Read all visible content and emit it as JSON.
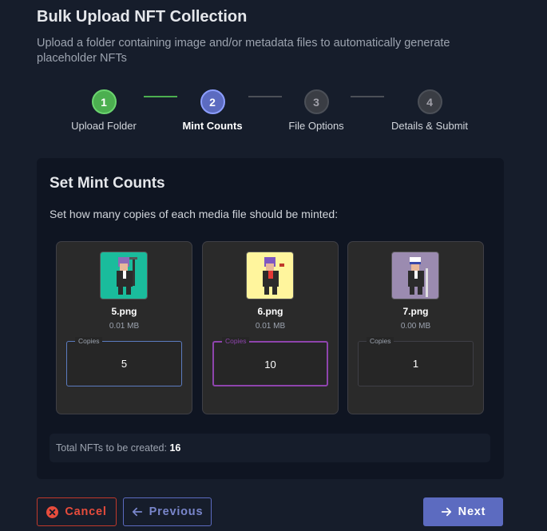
{
  "header": {
    "title": "Bulk Upload NFT Collection",
    "subtitle": "Upload a folder containing image and/or metadata files to automatically generate placeholder NFTs"
  },
  "stepper": {
    "steps": [
      {
        "number": "1",
        "label": "Upload Folder",
        "state": "done"
      },
      {
        "number": "2",
        "label": "Mint Counts",
        "state": "active"
      },
      {
        "number": "3",
        "label": "File Options",
        "state": "todo"
      },
      {
        "number": "4",
        "label": "Details & Submit",
        "state": "todo"
      }
    ]
  },
  "mint_counts": {
    "title": "Set Mint Counts",
    "description": "Set how many copies of each media file should be minted:",
    "copies_label": "Copies",
    "files": [
      {
        "name": "5.png",
        "size": "0.01 MB",
        "copies": "5",
        "thumb_color": "#1abc9c"
      },
      {
        "name": "6.png",
        "size": "0.01 MB",
        "copies": "10",
        "thumb_color": "#fff59d"
      },
      {
        "name": "7.png",
        "size": "0.00 MB",
        "copies": "1",
        "thumb_color": "#9b8bb0"
      }
    ],
    "total_label": "Total NFTs to be created:",
    "total_value": "16"
  },
  "footer": {
    "cancel_label": "Cancel",
    "previous_label": "Previous",
    "next_label": "Next"
  },
  "colors": {
    "accent": "#5c6bc0",
    "success": "#4caf50",
    "danger": "#e74c3c"
  }
}
